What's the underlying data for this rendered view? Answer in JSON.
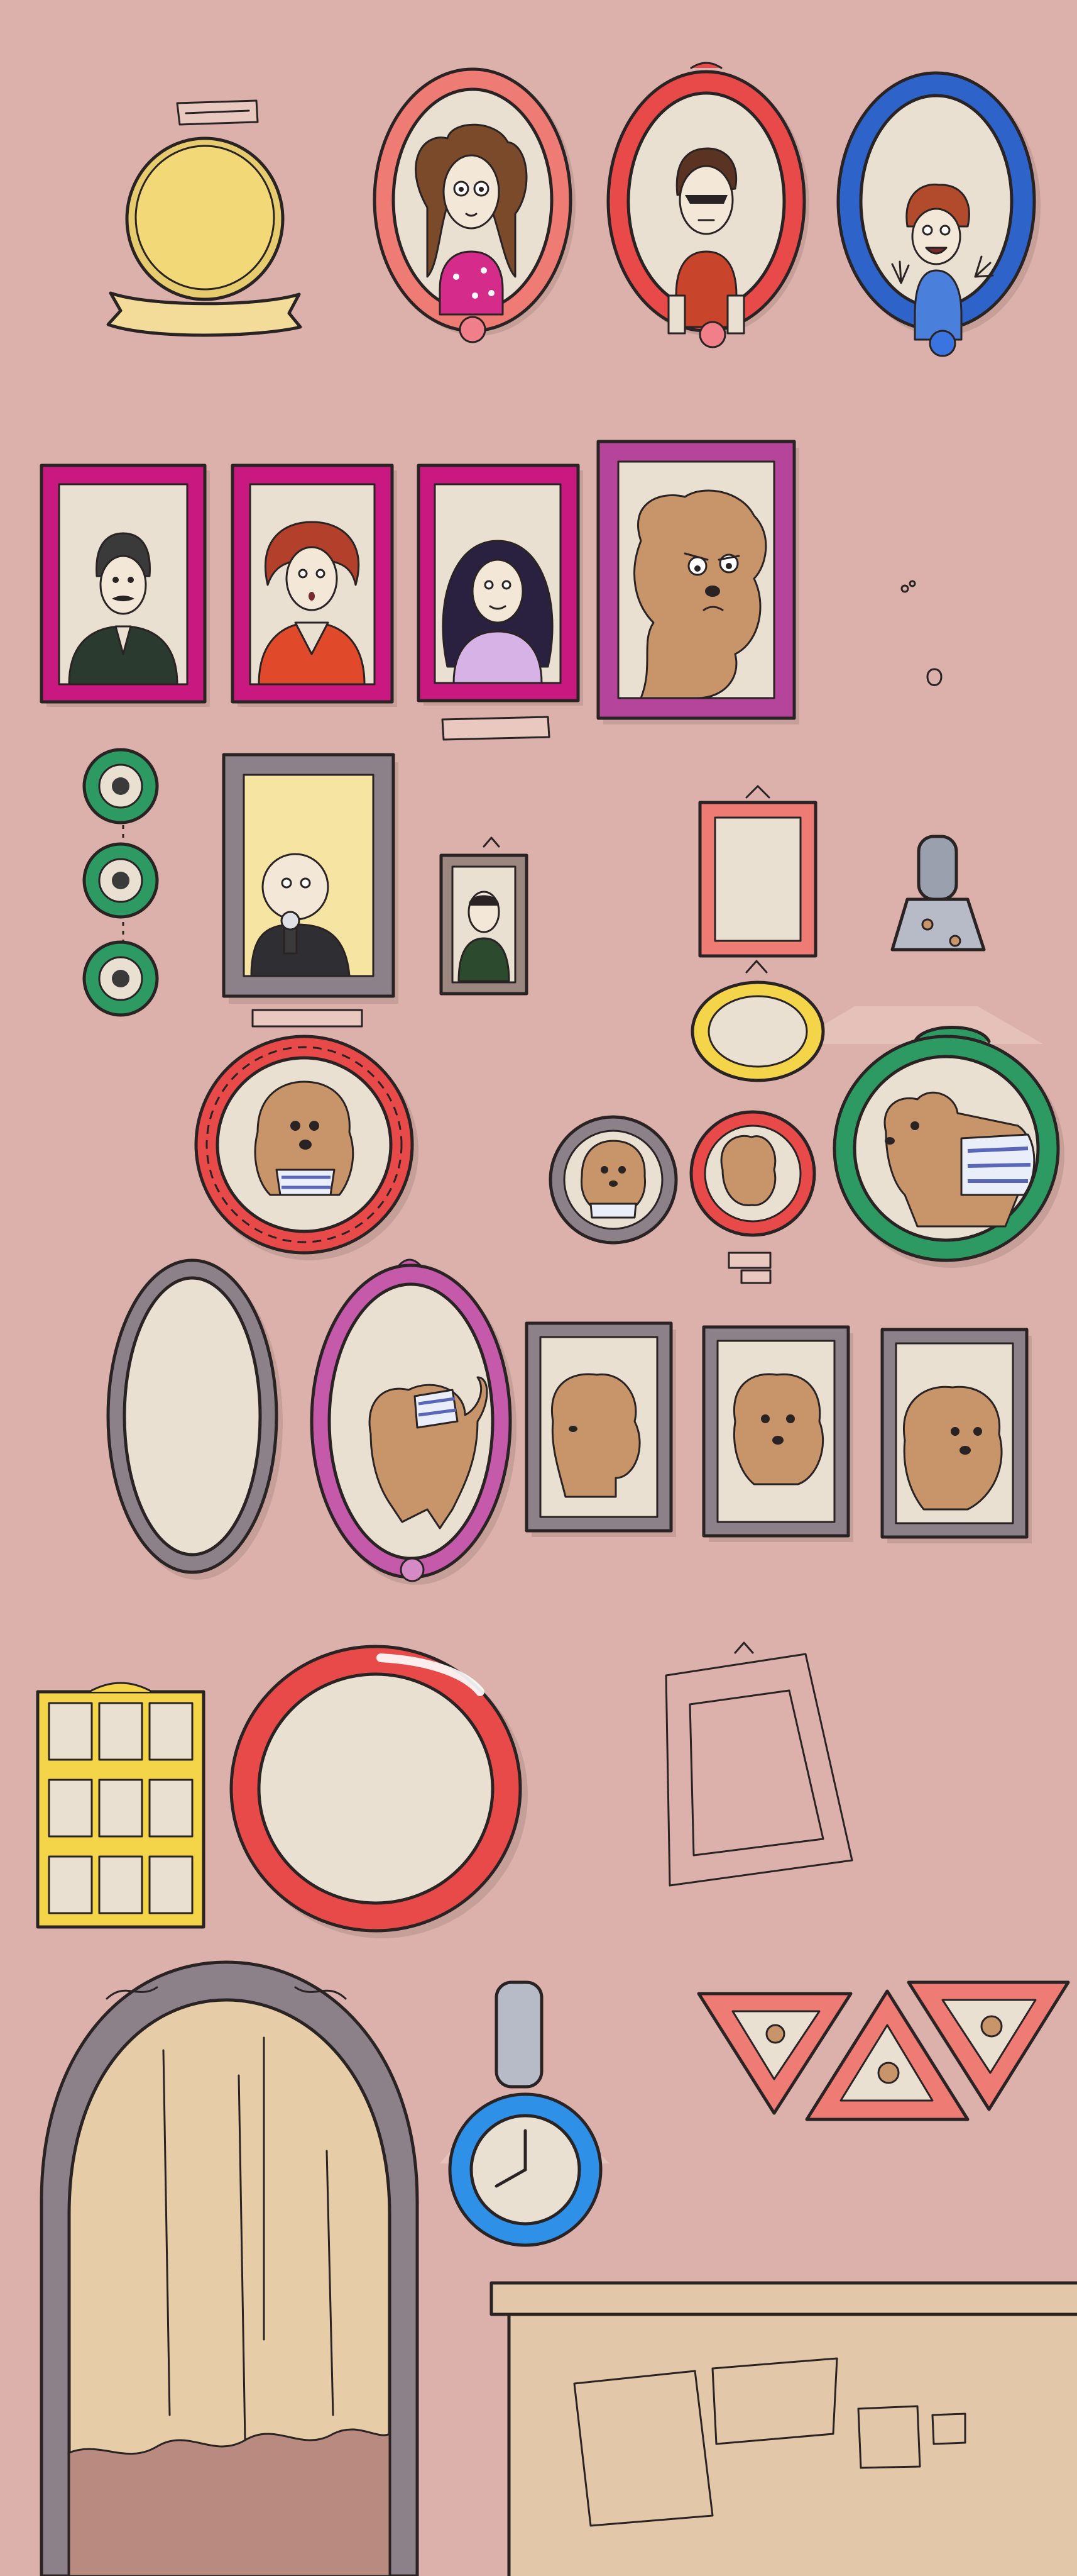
{
  "scene": {
    "name": "family-portrait-wall",
    "colors": {
      "wall": "#dcb1ab",
      "canvas": "#eae0d2",
      "outline": "#2a2323",
      "frame_salmon": "#ef7c74",
      "frame_red": "#e84a4a",
      "frame_blue": "#2e63c9",
      "frame_magenta": "#c9187f",
      "frame_purple": "#b5459a",
      "frame_gray": "#8c8089",
      "frame_green": "#2e9a63",
      "frame_yellow": "#f4d54a",
      "frame_pink_violet": "#c45aa9",
      "poodle": "#c8956b",
      "cabinet": "#e2c8a8",
      "mirror_curtain": "#e6cda7"
    }
  },
  "portraits": {
    "family": [
      {
        "subject": "curly-haired-woman",
        "frame": "salmon-oval"
      },
      {
        "subject": "boy-with-sunglasses",
        "frame": "red-oval"
      },
      {
        "subject": "waving-kid",
        "frame": "blue-oval"
      },
      {
        "subject": "mustache-man",
        "frame": "magenta-rect"
      },
      {
        "subject": "redhead-woman",
        "frame": "magenta-rect"
      },
      {
        "subject": "dark-hair-woman",
        "frame": "magenta-rect"
      },
      {
        "subject": "poodle-grumpy",
        "frame": "purple-rect"
      },
      {
        "subject": "bald-man-microphone",
        "frame": "gray-rect"
      },
      {
        "subject": "young-man",
        "frame": "small-rect"
      }
    ],
    "poodles": [
      {
        "pose": "sweater-front",
        "frame": "red-round"
      },
      {
        "pose": "small-front",
        "frame": "gray-round"
      },
      {
        "pose": "small-side",
        "frame": "red-round"
      },
      {
        "pose": "sweater-side",
        "frame": "green-round"
      },
      {
        "pose": "standing-sweater",
        "frame": "pink-oval"
      },
      {
        "pose": "head-left",
        "frame": "gray-rect"
      },
      {
        "pose": "head-center",
        "frame": "gray-rect"
      },
      {
        "pose": "head-right",
        "frame": "gray-rect"
      },
      {
        "pose": "paw-print",
        "frame": "triangle"
      },
      {
        "pose": "paw-print",
        "frame": "triangle"
      },
      {
        "pose": "paw-print",
        "frame": "triangle"
      }
    ]
  },
  "clock": {
    "hour_hand": "9",
    "minute_hand": "12"
  }
}
